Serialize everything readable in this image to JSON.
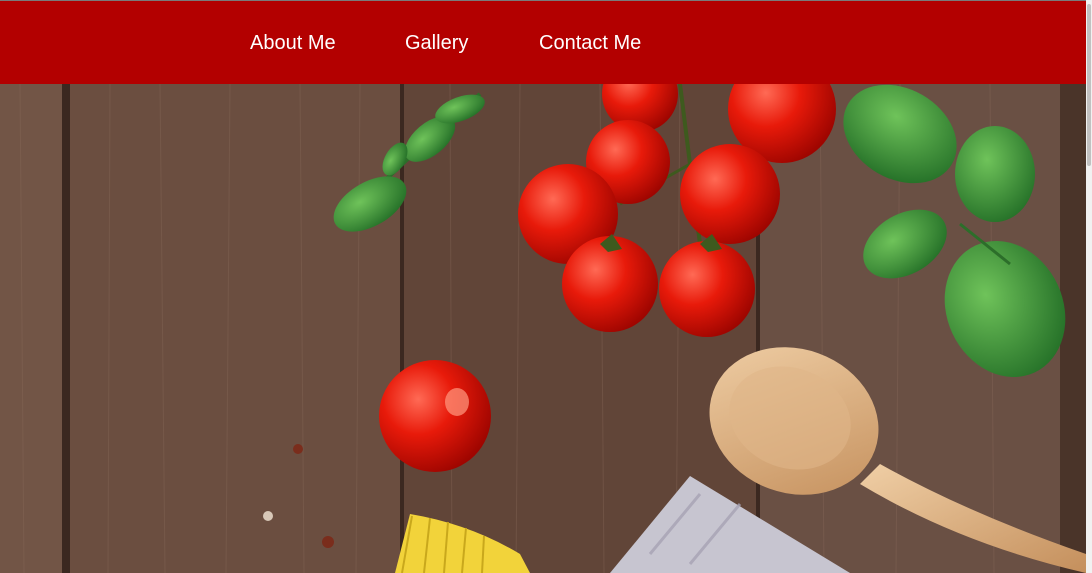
{
  "nav": {
    "items": [
      {
        "label": "About Me"
      },
      {
        "label": "Gallery"
      },
      {
        "label": "Contact Me"
      }
    ]
  },
  "hero": {
    "image_subject": "cooking ingredients on wooden table: cherry tomatoes, basil, wooden spoon, pasta, linen cloth"
  },
  "colors": {
    "navbar": "#b30000",
    "nav_text": "#ffffff",
    "wood": "#6a4e3f"
  }
}
